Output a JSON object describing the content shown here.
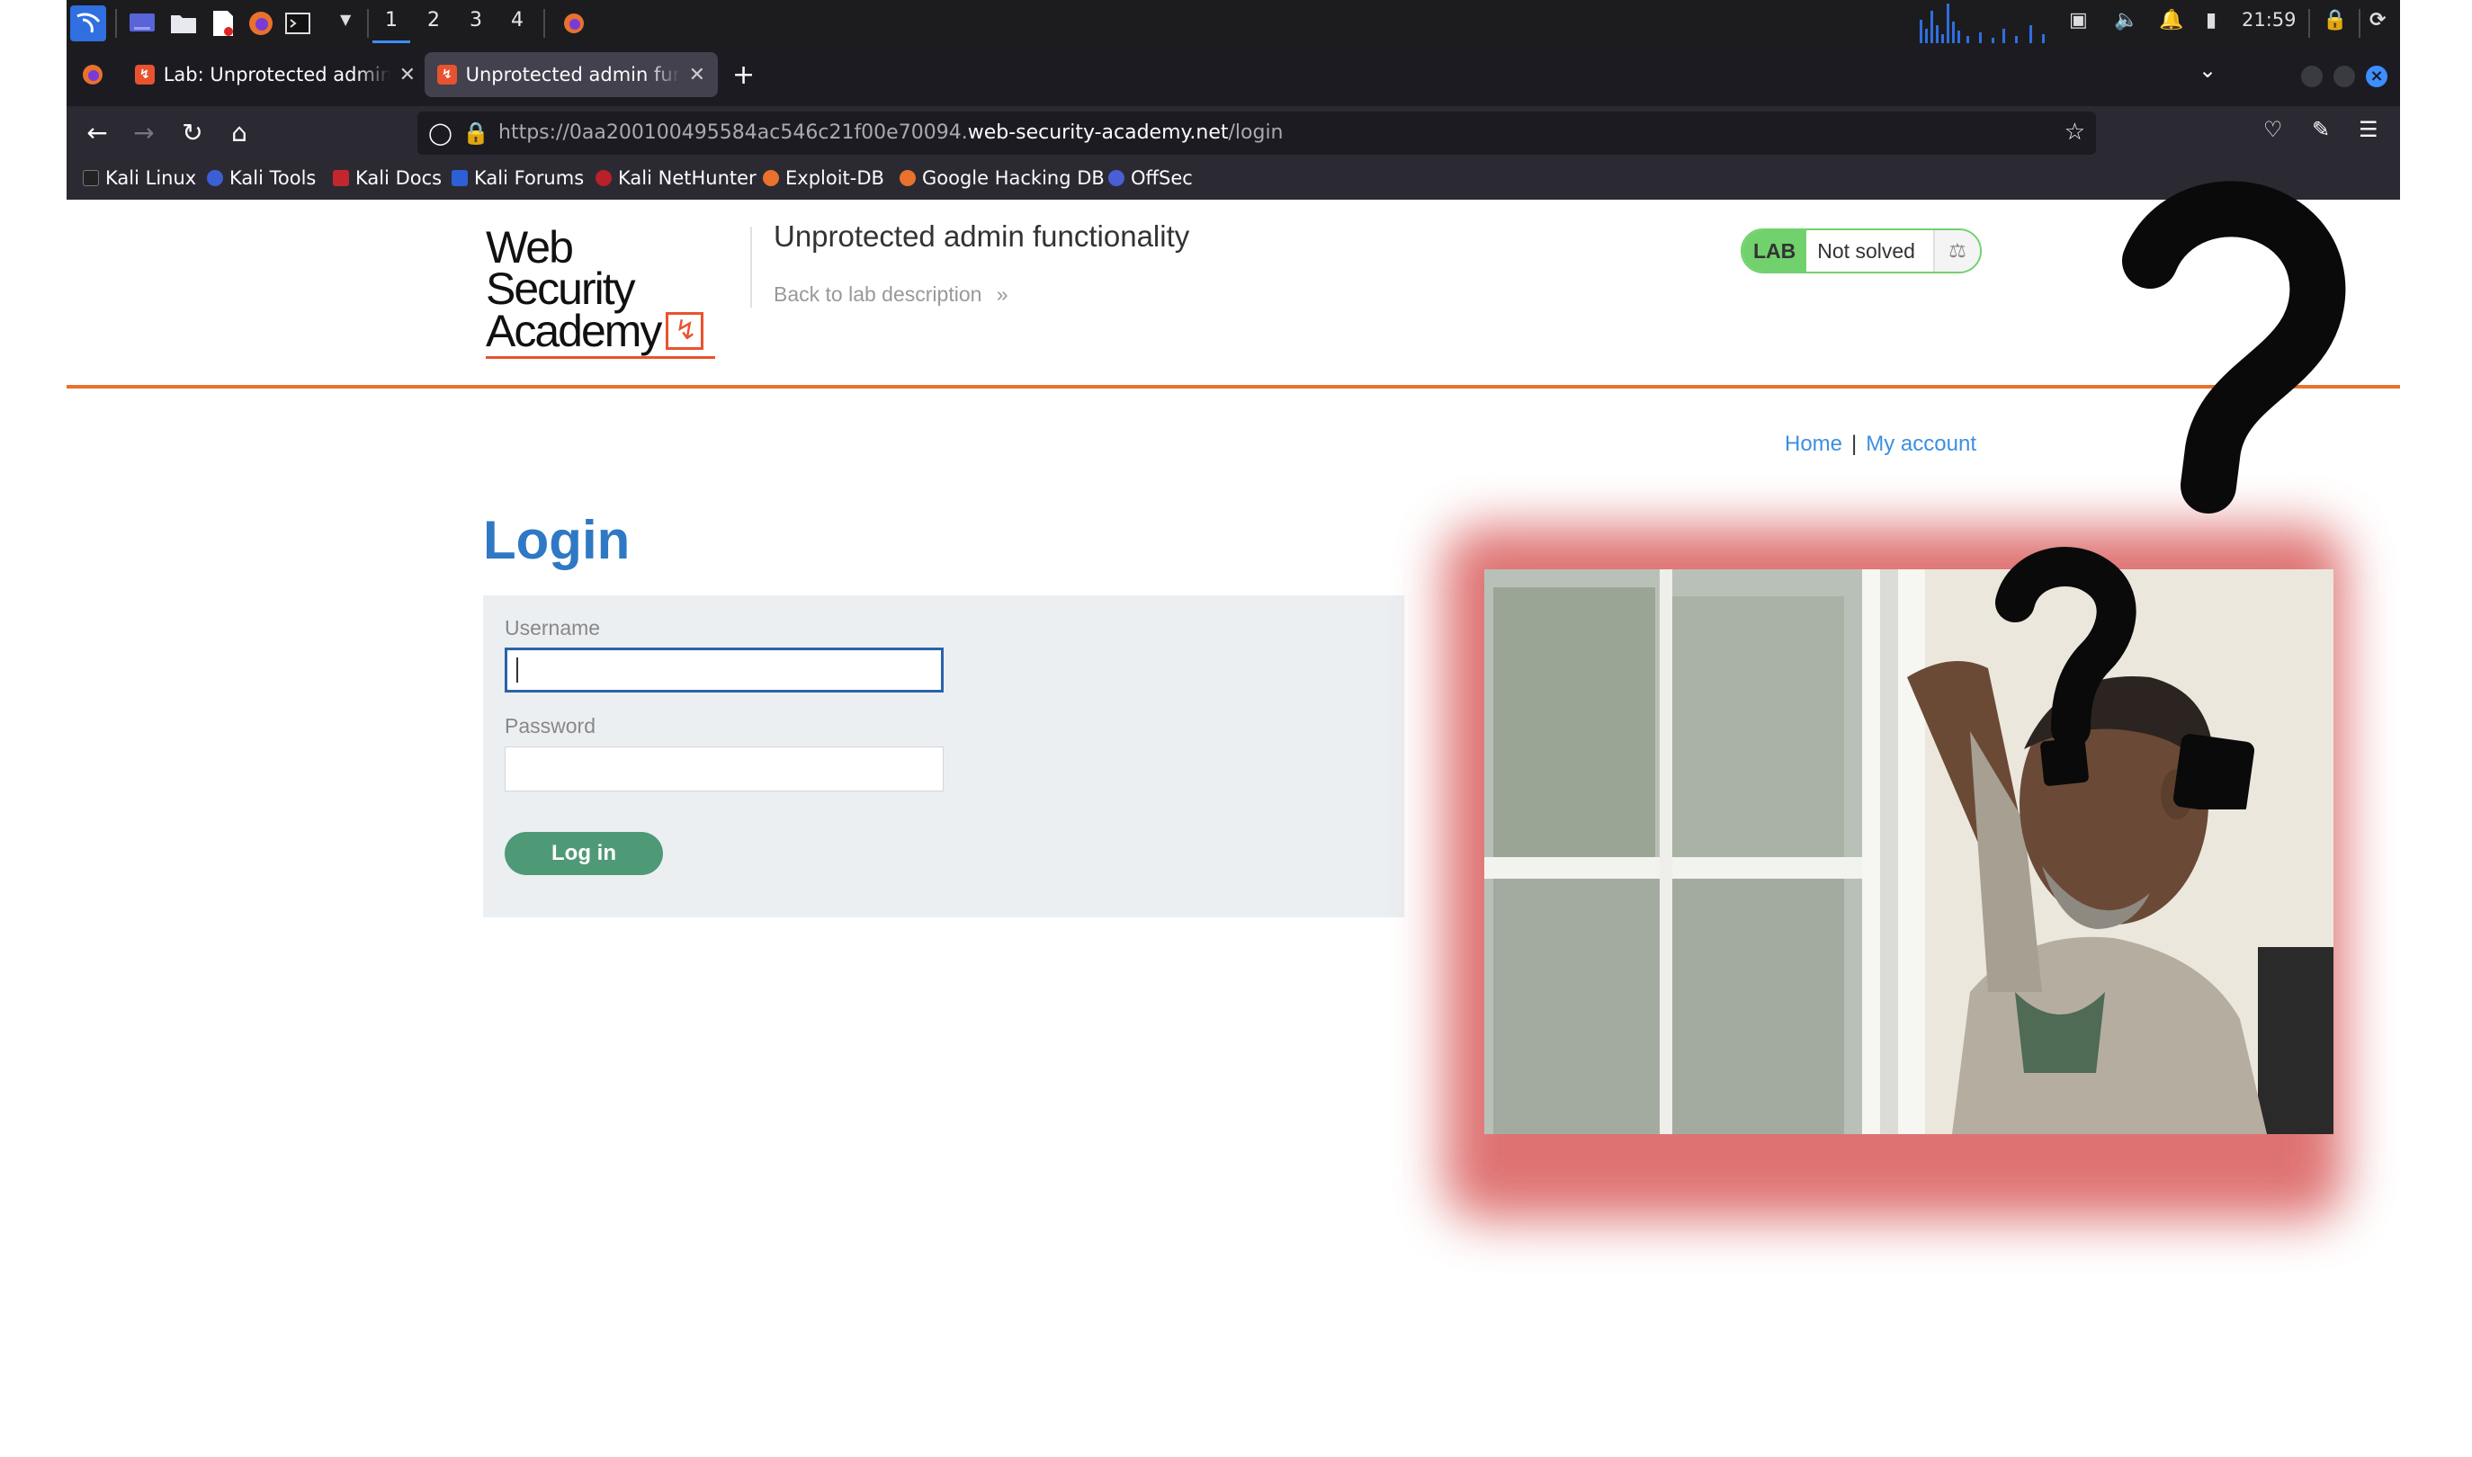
{
  "panel": {
    "workspaces": [
      "1",
      "2",
      "3",
      "4"
    ],
    "active_workspace": "1",
    "clock": "21:59",
    "icons": [
      "kali-menu-icon",
      "desktop-icon",
      "files-icon",
      "text-editor-icon",
      "firefox-icon",
      "terminal-icon",
      "volume-icon",
      "bell-icon",
      "battery-icon",
      "lock-icon",
      "power-icon"
    ]
  },
  "browser": {
    "tabs": [
      {
        "title": "Lab: Unprotected admin f",
        "active": false
      },
      {
        "title": "Unprotected admin functi",
        "active": true
      }
    ],
    "url": {
      "prefix": "https://0aa200100495584ac546c21f00e70094.",
      "host": "web-security-academy.net",
      "path": "/login"
    },
    "bookmarks": [
      "Kali Linux",
      "Kali Tools",
      "Kali Docs",
      "Kali Forums",
      "Kali NetHunter",
      "Exploit-DB",
      "Google Hacking DB",
      "OffSec"
    ]
  },
  "header": {
    "logo_line1": "Web Security",
    "logo_line2": "Academy",
    "lab_title": "Unprotected admin functionality",
    "back_link": "Back to lab description",
    "badge_label": "LAB",
    "badge_status": "Not solved"
  },
  "nav": {
    "home": "Home",
    "separator": "|",
    "my_account": "My account"
  },
  "login": {
    "heading": "Login",
    "username_label": "Username",
    "username_value": "",
    "password_label": "Password",
    "password_value": "",
    "button_label": "Log in"
  },
  "colors": {
    "accent_orange": "#e8722d",
    "heading_blue": "#2f78c4",
    "link_blue": "#3c8fe0",
    "button_green": "#4f9a76",
    "badge_green": "#70d16d",
    "overlay_glow": "#d95a5a"
  }
}
